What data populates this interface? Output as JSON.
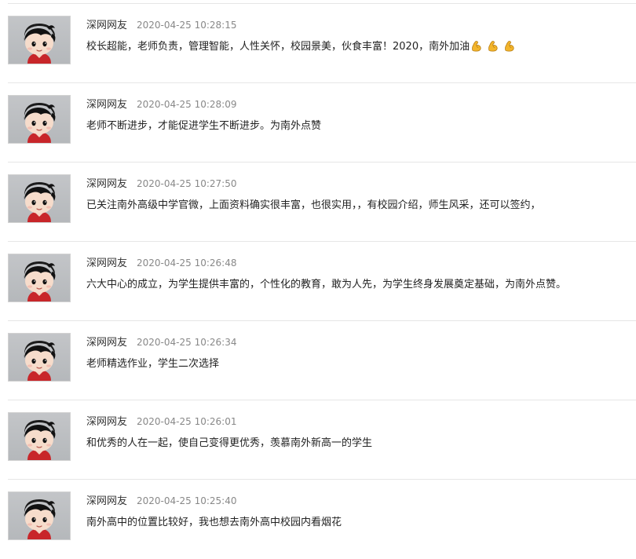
{
  "comments": [
    {
      "author": "深网网友",
      "time": "2020-04-25 10:28:15",
      "text": "校长超能，老师负责，管理智能，人性关怀，校园景美，伙食丰富！2020，南外加油",
      "emoji": [
        "flexed-biceps",
        "flexed-biceps",
        "flexed-biceps"
      ],
      "avatar": "cartoon-boy-avatar"
    },
    {
      "author": "深网网友",
      "time": "2020-04-25 10:28:09",
      "text": "老师不断进步，才能促进学生不断进步。为南外点赞",
      "emoji": [],
      "avatar": "cartoon-boy-avatar"
    },
    {
      "author": "深网网友",
      "time": "2020-04-25 10:27:50",
      "text": "已关注南外高级中学官微，上面资料确实很丰富，也很实用，，有校园介绍，师生风采，还可以签约，",
      "emoji": [],
      "avatar": "cartoon-boy-avatar"
    },
    {
      "author": "深网网友",
      "time": "2020-04-25 10:26:48",
      "text": "六大中心的成立，为学生提供丰富的，个性化的教育，敢为人先，为学生终身发展奠定基础，为南外点赞。",
      "emoji": [],
      "avatar": "cartoon-boy-avatar"
    },
    {
      "author": "深网网友",
      "time": "2020-04-25 10:26:34",
      "text": "老师精选作业，学生二次选择",
      "emoji": [],
      "avatar": "cartoon-boy-avatar"
    },
    {
      "author": "深网网友",
      "time": "2020-04-25 10:26:01",
      "text": "和优秀的人在一起，使自己变得更优秀，羡慕南外新高一的学生",
      "emoji": [],
      "avatar": "cartoon-boy-avatar"
    },
    {
      "author": "深网网友",
      "time": "2020-04-25 10:25:40",
      "text": "南外高中的位置比较好，我也想去南外高中校园内看烟花",
      "emoji": [],
      "avatar": "cartoon-boy-avatar"
    }
  ],
  "colors": {
    "author": "#333333",
    "time": "#888888",
    "text": "#222222",
    "divider": "#e6e6e6",
    "emoji": "#f3b52c"
  }
}
